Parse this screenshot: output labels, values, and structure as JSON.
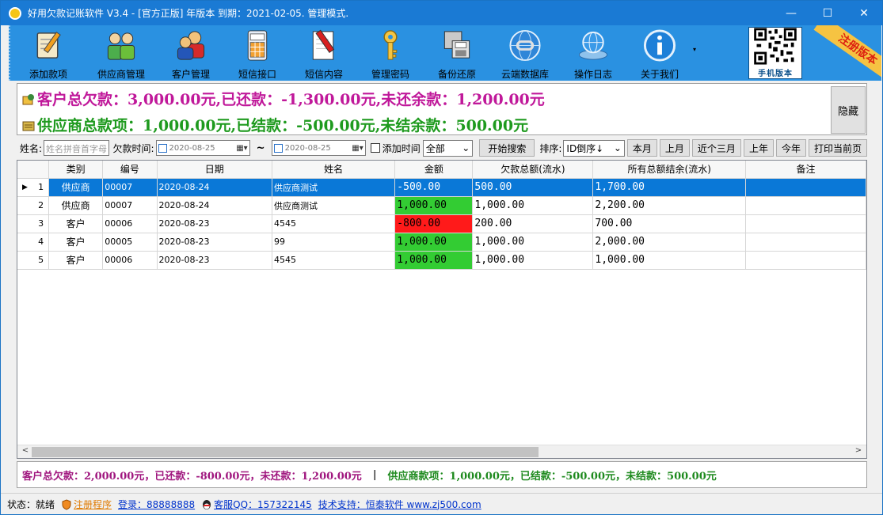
{
  "window": {
    "title": "好用欠款记账软件 V3.4 -  [官方正版]  年版本  到期：2021-02-05.  管理模式.",
    "controls": [
      "—",
      "☐",
      "✕"
    ]
  },
  "toolbar": {
    "items": [
      {
        "label": "添加款项",
        "icon": "notepad-pencil-icon"
      },
      {
        "label": "供应商管理",
        "icon": "people-icon"
      },
      {
        "label": "客户管理",
        "icon": "customers-icon"
      },
      {
        "label": "短信接口",
        "icon": "calculator-icon"
      },
      {
        "label": "短信内容",
        "icon": "document-edit-icon"
      },
      {
        "label": "管理密码",
        "icon": "key-icon"
      },
      {
        "label": "备份还原",
        "icon": "backup-icon"
      },
      {
        "label": "云端数据库",
        "icon": "cloud-database-icon"
      },
      {
        "label": "操作日志",
        "icon": "globe-log-icon"
      },
      {
        "label": "关于我们",
        "icon": "info-icon"
      }
    ],
    "overflow": "▾",
    "qr_label": "手机版本",
    "ribbon": "注册版本"
  },
  "summary": {
    "customer_line": "客户总欠款：3,000.00元,已还款：-1,300.00元,未还余款：1,200.00元",
    "supplier_line": "供应商总款项：1,000.00元,已结款：-500.00元,未结余款：500.00元",
    "hide_button": "隐藏",
    "colors": {
      "customer": "#c0189a",
      "supplier": "#1e9a1e"
    }
  },
  "filter": {
    "name_label": "姓名:",
    "name_placeholder": "姓名拼音首字母",
    "time_label": "欠款时间:",
    "date_from": "2020-08-25",
    "date_to": "2020-08-25",
    "tilde": "~",
    "add_time_label": "添加时间",
    "type_select": "全部",
    "search_button": "开始搜索",
    "sort_label": "排序:",
    "sort_select": "ID倒序↓",
    "buttons": [
      "本月",
      "上月",
      "近个三月",
      "上年",
      "今年",
      "打印当前页"
    ]
  },
  "grid": {
    "columns": [
      "",
      "类别",
      "编号",
      "日期",
      "姓名",
      "金额",
      "欠款总额(流水)",
      "所有总额结余(流水)",
      "备注"
    ],
    "rows": [
      {
        "no": "1",
        "type": "供应商",
        "code": "00007",
        "date": "2020-08-24",
        "name": "供应商测试",
        "amount": "-500.00",
        "total": "500.00",
        "balance": "1,700.00",
        "note": "",
        "amount_color": "sel",
        "selected": true
      },
      {
        "no": "2",
        "type": "供应商",
        "code": "00007",
        "date": "2020-08-24",
        "name": "供应商测试",
        "amount": "1,000.00",
        "total": "1,000.00",
        "balance": "2,200.00",
        "note": "",
        "amount_color": "#33cc33",
        "selected": false
      },
      {
        "no": "3",
        "type": "客户",
        "code": "00006",
        "date": "2020-08-23",
        "name": "4545",
        "amount": "-800.00",
        "total": "200.00",
        "balance": "700.00",
        "note": "",
        "amount_color": "#ff1a1a",
        "selected": false
      },
      {
        "no": "4",
        "type": "客户",
        "code": "00005",
        "date": "2020-08-23",
        "name": "99",
        "amount": "1,000.00",
        "total": "1,000.00",
        "balance": "2,000.00",
        "note": "",
        "amount_color": "#33cc33",
        "selected": false
      },
      {
        "no": "5",
        "type": "客户",
        "code": "00006",
        "date": "2020-08-23",
        "name": "4545",
        "amount": "1,000.00",
        "total": "1,000.00",
        "balance": "1,000.00",
        "note": "",
        "amount_color": "#33cc33",
        "selected": false
      }
    ],
    "scroll_left": "<",
    "scroll_right": ">"
  },
  "footer": {
    "customer": "客户总欠款：2,000.00元，已还款：-800.00元，未还款：1,200.00元",
    "separator": "|",
    "supplier": "供应商款项：1,000.00元，已结款：-500.00元，未结款：500.00元"
  },
  "status": {
    "state_label": "状态：就绪",
    "register": "注册程序",
    "login": "登录：88888888",
    "qq": "客服QQ：157322145",
    "support": "技术支持：恒泰软件  www.zj500.com"
  }
}
